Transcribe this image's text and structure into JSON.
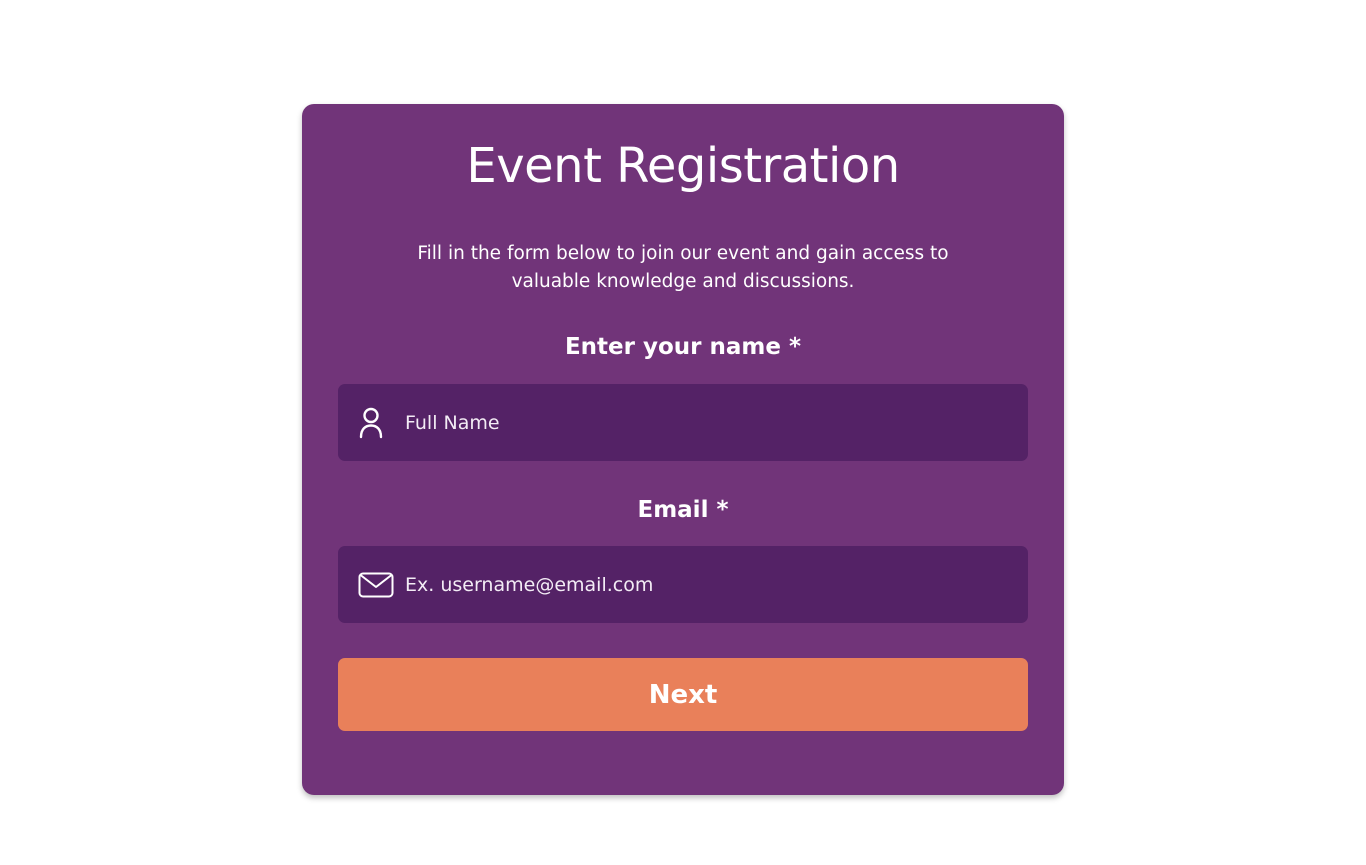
{
  "form": {
    "title": "Event Registration",
    "subtitle": "Fill in the form below to join our event and gain access to valuable knowledge and discussions.",
    "name_field": {
      "label": "Enter your name *",
      "placeholder": "Full Name",
      "value": "",
      "icon": "user-icon"
    },
    "email_field": {
      "label": "Email *",
      "placeholder": "Ex. username@email.com",
      "value": "",
      "icon": "mail-icon"
    },
    "submit_label": "Next"
  },
  "colors": {
    "page_background": "#ffffff",
    "card_background": "#713479",
    "input_background": "#542266",
    "button_background": "#e9805a",
    "text": "#ffffff"
  }
}
